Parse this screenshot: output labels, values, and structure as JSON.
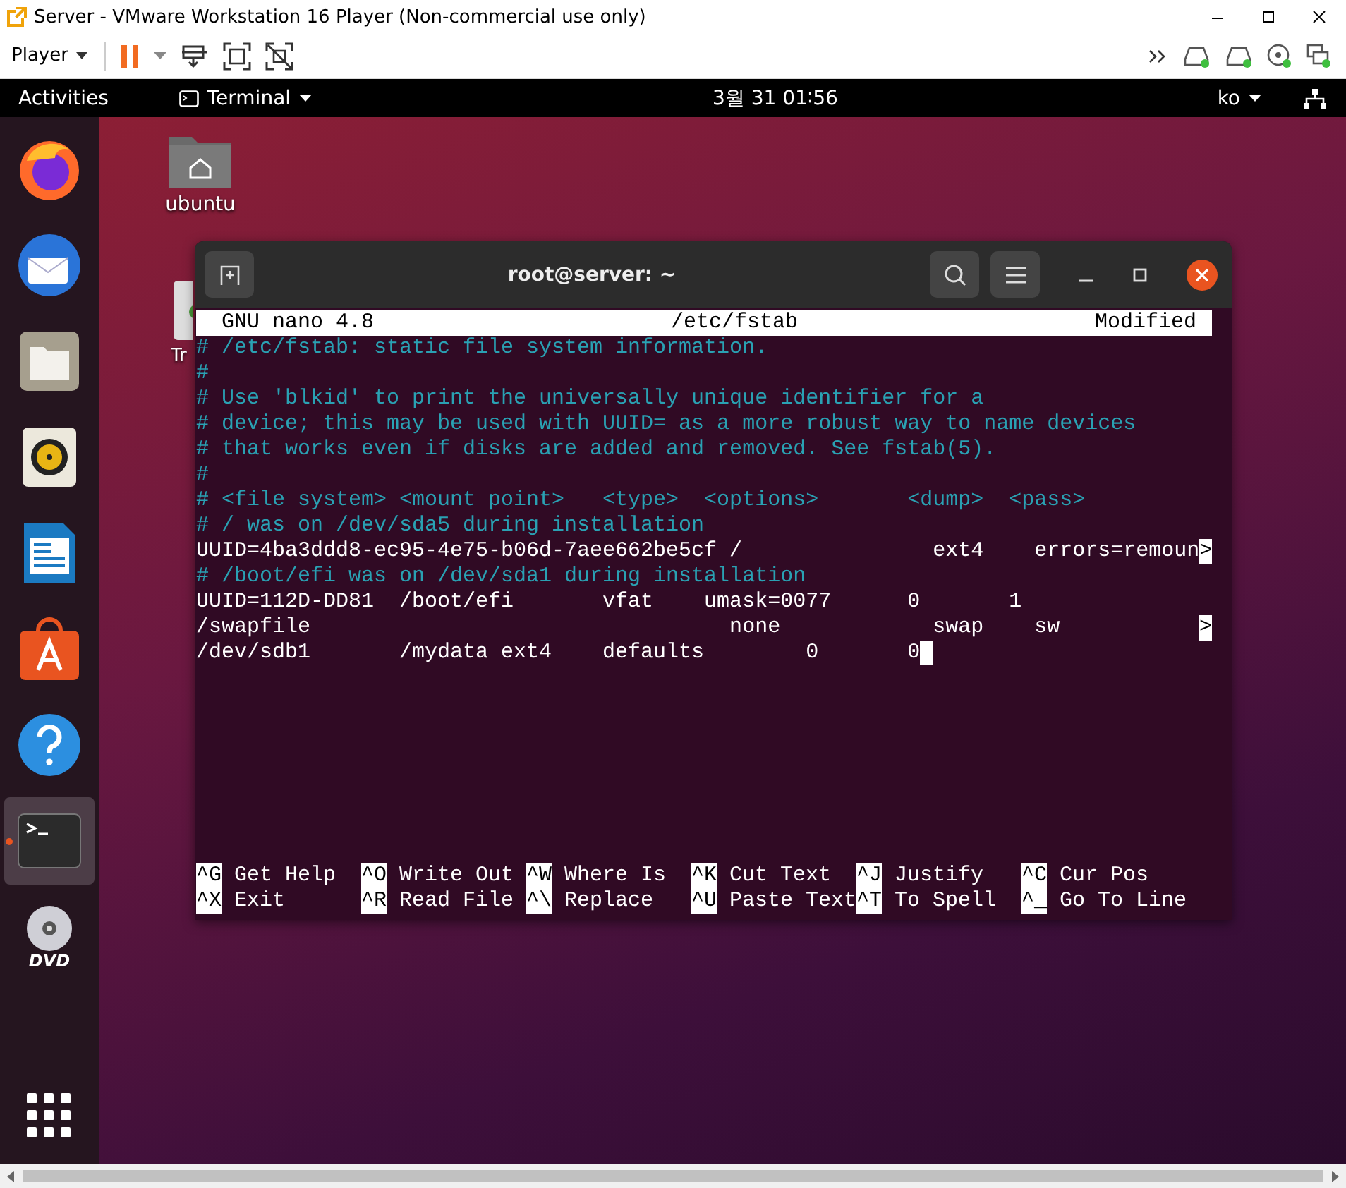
{
  "vm_window": {
    "title": "Server - VMware Workstation 16 Player (Non-commercial use only)"
  },
  "vm_toolbar": {
    "player_menu": "Player"
  },
  "top_bar": {
    "activities": "Activities",
    "app_menu": "Terminal",
    "clock": "3월 31  01∶56",
    "input_method": "ko"
  },
  "dock": [
    {
      "kind": "firefox",
      "running": false,
      "active": false
    },
    {
      "kind": "thunderbird",
      "running": false,
      "active": false
    },
    {
      "kind": "files",
      "running": false,
      "active": false
    },
    {
      "kind": "rhythmbox",
      "running": false,
      "active": false
    },
    {
      "kind": "writer",
      "running": false,
      "active": false
    },
    {
      "kind": "software",
      "running": false,
      "active": false
    },
    {
      "kind": "help",
      "running": false,
      "active": false
    },
    {
      "kind": "terminal",
      "running": true,
      "active": true
    },
    {
      "kind": "dvd",
      "running": false,
      "active": false,
      "label": "DVD"
    }
  ],
  "desktop_icons": [
    {
      "kind": "home-folder",
      "label": "ubuntu"
    },
    {
      "kind": "trash",
      "label": "Tr"
    }
  ],
  "terminal": {
    "title": "root@server: ~",
    "nano_header": {
      "version": "GNU nano 4.8",
      "file": "/etc/fstab",
      "status": "Modified"
    },
    "lines": [
      {
        "kind": "comment",
        "text": "# /etc/fstab: static file system information."
      },
      {
        "kind": "comment",
        "text": "#"
      },
      {
        "kind": "comment",
        "text": "# Use 'blkid' to print the universally unique identifier for a"
      },
      {
        "kind": "comment",
        "text": "# device; this may be used with UUID= as a more robust way to name devices"
      },
      {
        "kind": "comment",
        "text": "# that works even if disks are added and removed. See fstab(5)."
      },
      {
        "kind": "comment",
        "text": "#"
      },
      {
        "kind": "comment",
        "text": "# <file system> <mount point>   <type>  <options>       <dump>  <pass>"
      },
      {
        "kind": "comment",
        "text": "# / was on /dev/sda5 during installation"
      },
      {
        "kind": "plain",
        "text": "UUID=4ba3ddd8-ec95-4e75-b06d-7aee662be5cf /               ext4    errors=remoun",
        "more": ">"
      },
      {
        "kind": "comment",
        "text": "# /boot/efi was on /dev/sda1 during installation"
      },
      {
        "kind": "plain",
        "text": "UUID=112D-DD81  /boot/efi       vfat    umask=0077      0       1"
      },
      {
        "kind": "plain",
        "text": "/swapfile                                 none            swap    sw",
        "more": ">"
      },
      {
        "kind": "plain",
        "text": "/dev/sdb1       /mydata ext4    defaults        0       0",
        "cursor": true
      }
    ],
    "shortcuts": [
      [
        {
          "key": "^G",
          "label": "Get Help"
        },
        {
          "key": "^O",
          "label": "Write Out"
        },
        {
          "key": "^W",
          "label": "Where Is"
        },
        {
          "key": "^K",
          "label": "Cut Text"
        },
        {
          "key": "^J",
          "label": "Justify"
        },
        {
          "key": "^C",
          "label": "Cur Pos"
        }
      ],
      [
        {
          "key": "^X",
          "label": "Exit"
        },
        {
          "key": "^R",
          "label": "Read File"
        },
        {
          "key": "^\\",
          "label": "Replace"
        },
        {
          "key": "^U",
          "label": "Paste Text"
        },
        {
          "key": "^T",
          "label": "To Spell"
        },
        {
          "key": "^_",
          "label": "Go To Line"
        }
      ]
    ]
  }
}
